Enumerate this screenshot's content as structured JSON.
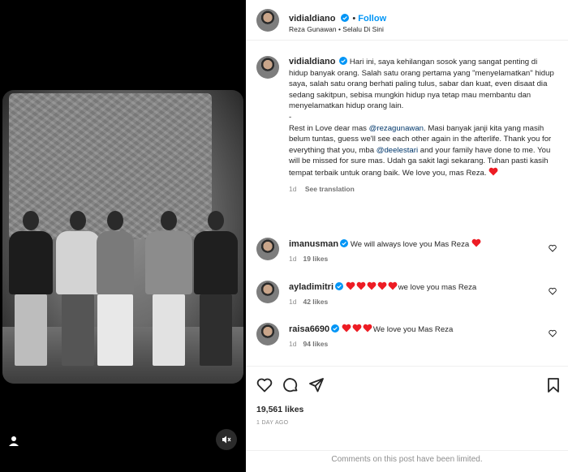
{
  "header": {
    "username": "vidialdiano",
    "follow_label": "Follow",
    "subtitle": "Reza Gunawan • Selalu Di Sini"
  },
  "caption": {
    "username": "vidialdiano",
    "text_intro": "Hari ini, saya kehilangan sosok yang sangat penting di hidup banyak orang. Salah satu orang pertama yang \"menyelamatkan\" hidup saya, salah satu orang berhati paling tulus, sabar dan kuat, even disaat dia sedang sakitpun, sebisa mungkin hidup nya tetap mau membantu dan menyelamatkan hidup orang lain.",
    "separator": "-",
    "text_part1": "Rest in Love dear mas ",
    "mention1": "@rezagunawan",
    "text_part2": ". Masi banyak janji kita yang masih belum tuntas, guess we'll see each other again in the afterlife. Thank you for everything that you, mba ",
    "mention2": "@deelestari",
    "text_part3": " and your family have done to me. You will be missed for sure mas. Udah ga sakit lagi sekarang. Tuhan pasti kasih tempat terbaik untuk orang baik. We love you, mas Reza. ",
    "age": "1d",
    "translation_label": "See translation"
  },
  "comments": [
    {
      "username": "imanusman",
      "verified": true,
      "hearts_before": 0,
      "text": "We will always love you Mas Reza",
      "hearts_after": 1,
      "age": "1d",
      "likes": "19 likes"
    },
    {
      "username": "ayladimitri",
      "verified": true,
      "hearts_before": 5,
      "text": "we love you mas Reza",
      "hearts_after": 0,
      "age": "1d",
      "likes": "42 likes"
    },
    {
      "username": "raisa6690",
      "verified": true,
      "hearts_before": 3,
      "text": "We love you Mas Reza",
      "hearts_after": 0,
      "age": "1d",
      "likes": "94 likes"
    }
  ],
  "post": {
    "likes": "19,561 likes",
    "date": "1 DAY AGO",
    "limited_notice": "Comments on this post have been limited."
  },
  "colors": {
    "accent": "#0095f6",
    "verified": "#0095f6",
    "heart": "#ed1c24",
    "mention": "#00376b",
    "muted": "#8e8e8e"
  },
  "icons": [
    "verified-icon",
    "heart-icon",
    "comment-icon",
    "share-icon",
    "bookmark-icon",
    "user-tag-icon",
    "mute-icon"
  ]
}
